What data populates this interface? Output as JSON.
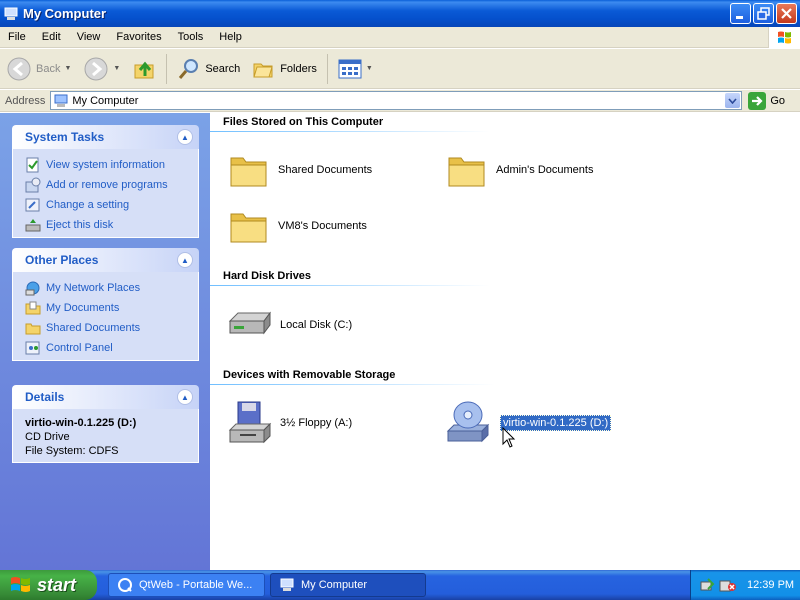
{
  "window": {
    "title": "My Computer"
  },
  "menu": [
    "File",
    "Edit",
    "View",
    "Favorites",
    "Tools",
    "Help"
  ],
  "toolbar": {
    "back": "Back",
    "search": "Search",
    "folders": "Folders"
  },
  "address": {
    "label": "Address",
    "value": "My Computer",
    "go": "Go"
  },
  "tasks": {
    "system": {
      "title": "System Tasks",
      "items": [
        "View system information",
        "Add or remove programs",
        "Change a setting",
        "Eject this disk"
      ]
    },
    "places": {
      "title": "Other Places",
      "items": [
        "My Network Places",
        "My Documents",
        "Shared Documents",
        "Control Panel"
      ]
    },
    "details": {
      "title": "Details",
      "name": "virtio-win-0.1.225 (D:)",
      "type": "CD Drive",
      "fs": "File System: CDFS"
    }
  },
  "groups": {
    "files": {
      "title": "Files Stored on This Computer",
      "items": [
        "Shared Documents",
        "Admin's Documents",
        "VM8's Documents"
      ]
    },
    "hdd": {
      "title": "Hard Disk Drives",
      "items": [
        "Local Disk (C:)"
      ]
    },
    "removable": {
      "title": "Devices with Removable Storage",
      "items": [
        "3½ Floppy (A:)",
        "virtio-win-0.1.225 (D:)"
      ]
    }
  },
  "taskbar": {
    "start": "start",
    "tasks": [
      "QtWeb - Portable We...",
      "My Computer"
    ],
    "clock": "12:39 PM"
  },
  "colors": {
    "titlebar": "#0a5ad6",
    "taskpane": "#6375d6",
    "link": "#215dc6",
    "start": "#47b247",
    "selection": "#316ac5"
  }
}
